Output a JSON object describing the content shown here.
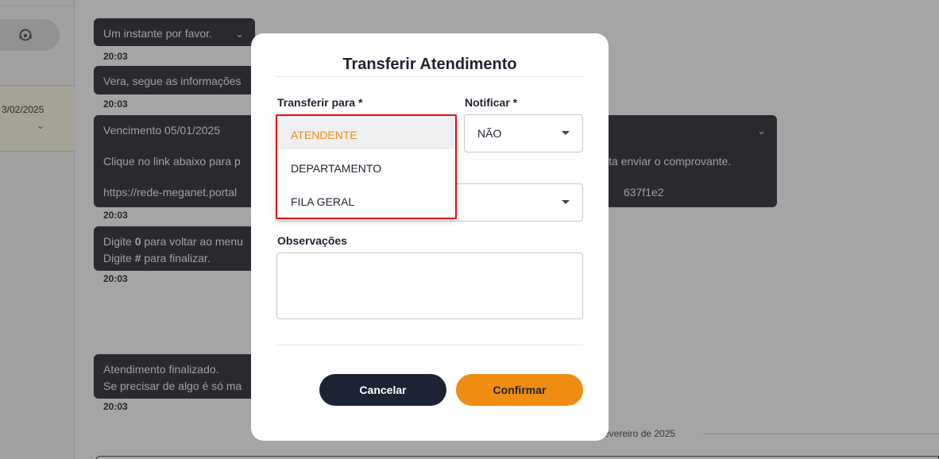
{
  "sidebar": {
    "contact_date": "3/02/2025"
  },
  "chat": {
    "messages": [
      {
        "lines": [
          "Um instante por favor."
        ],
        "time": "20:03",
        "has_chevron": true
      },
      {
        "lines": [
          "Vera, segue as informações"
        ],
        "time": "20:03"
      },
      {
        "lines": [
          "Vencimento 05/01/2025",
          "Clique no link abaixo para p",
          "https://rede-meganet.portal"
        ],
        "right_lines": [
          "ita enviar o comprovante.",
          "637f1e2"
        ],
        "time": "20:03",
        "has_chevron": true
      },
      {
        "lines_rich": [
          [
            "Digite ",
            "0",
            " para voltar ao menu"
          ],
          [
            "Digite ",
            "#",
            " para finalizar."
          ]
        ],
        "time": "20:03"
      },
      {
        "lines": [
          "Atendimento finalizado.",
          "Se precisar de algo é só ma"
        ],
        "time": "20:03"
      }
    ],
    "day_separator": "evereiro de 2025"
  },
  "modal": {
    "title": "Transferir Atendimento",
    "transfer_label": "Transferir para *",
    "notify_label": "Notificar *",
    "notify_value": "NÃO",
    "observations_label": "Observações",
    "observations_value": "",
    "cancel_label": "Cancelar",
    "confirm_label": "Confirmar",
    "transfer_options": [
      "ATENDENTE",
      "DEPARTAMENTO",
      "FILA GERAL"
    ],
    "transfer_highlighted": "ATENDENTE"
  },
  "colors": {
    "accent": "#ef8c12",
    "dark_button": "#1c2333",
    "bubble": "#3f4147",
    "highlight_border": "#e01010"
  }
}
